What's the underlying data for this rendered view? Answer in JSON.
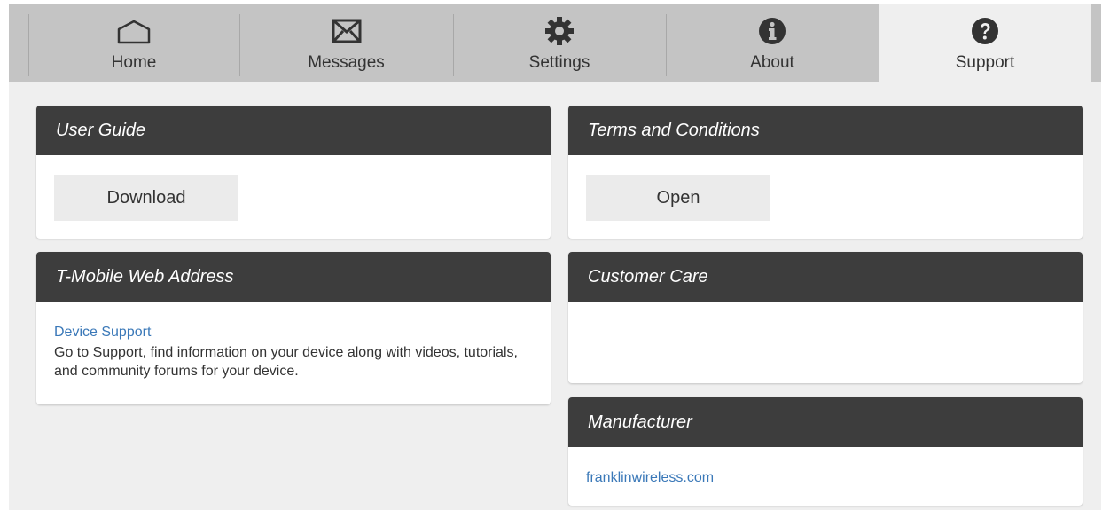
{
  "nav": {
    "tabs": [
      {
        "label": "Home",
        "icon": "home-icon"
      },
      {
        "label": "Messages",
        "icon": "envelope-icon"
      },
      {
        "label": "Settings",
        "icon": "gear-icon"
      },
      {
        "label": "About",
        "icon": "info-icon"
      },
      {
        "label": "Support",
        "icon": "question-icon",
        "active": true
      }
    ]
  },
  "cards": {
    "user_guide": {
      "title": "User Guide",
      "button": "Download"
    },
    "terms": {
      "title": "Terms and Conditions",
      "button": "Open"
    },
    "web_address": {
      "title": "T-Mobile Web Address",
      "link": "Device Support",
      "description": "Go to Support, find information on your device along with videos, tutorials, and community forums for your device."
    },
    "customer_care": {
      "title": "Customer Care"
    },
    "manufacturer": {
      "title": "Manufacturer",
      "link": "franklinwireless.com"
    }
  },
  "colors": {
    "card_header": "#3d3d3d",
    "link": "#3a78b8",
    "nav_bg": "#c4c4c4",
    "page_bg": "#efefef"
  }
}
